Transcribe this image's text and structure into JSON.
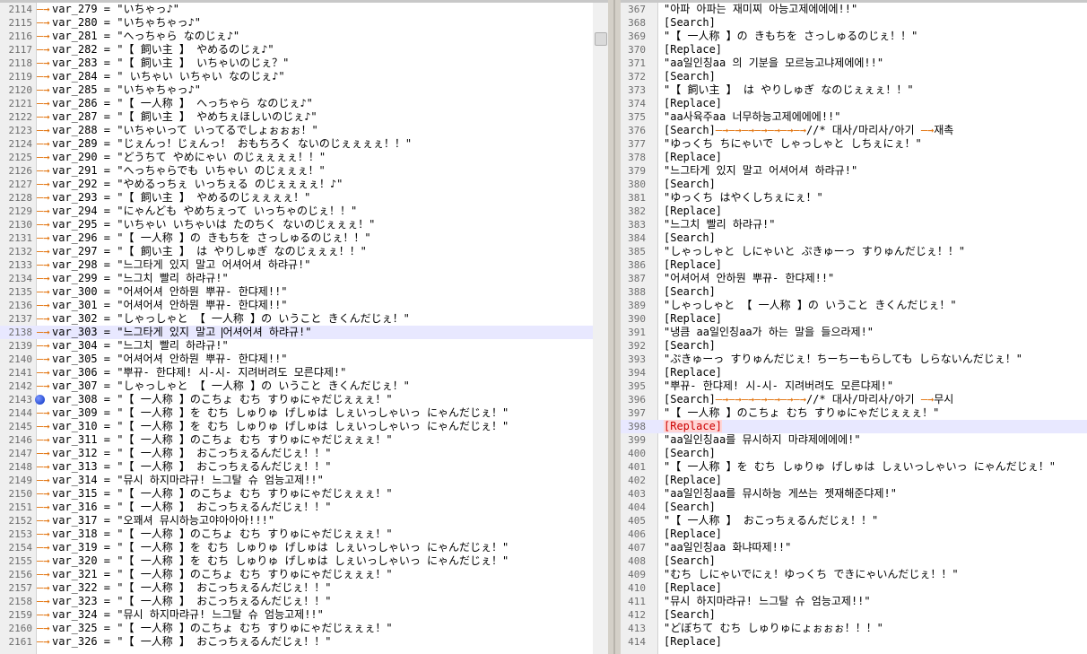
{
  "left_pane": {
    "current_line_index": 24,
    "bookmark_line_index": 29,
    "caret_after": "\"느그타게 있지 말고 ",
    "lines": [
      {
        "no": "2114",
        "text": "var_279 = \"いちゃっ♪\""
      },
      {
        "no": "2115",
        "text": "var_280 = \"いちゃちゃっ♪\""
      },
      {
        "no": "2116",
        "text": "var_281 = \"へっちゃら なのじぇ♪\""
      },
      {
        "no": "2117",
        "text": "var_282 = \"【 飼い主 】 やめるのじぇ♪\""
      },
      {
        "no": "2118",
        "text": "var_283 = \"【 飼い主 】 いちゃいのじぇ？\""
      },
      {
        "no": "2119",
        "text": "var_284 = \" いちゃい いちゃい なのじぇ♪\""
      },
      {
        "no": "2120",
        "text": "var_285 = \"いちゃちゃっ♪\""
      },
      {
        "no": "2121",
        "text": "var_286 = \"【 一人称 】 へっちゃら なのじぇ♪\""
      },
      {
        "no": "2122",
        "text": "var_287 = \"【 飼い主 】 やめちぇほしいのじぇ♪\""
      },
      {
        "no": "2123",
        "text": "var_288 = \"いちゃいって いってるでしょぉぉぉ！\""
      },
      {
        "no": "2124",
        "text": "var_289 = \"じぇんっ！じぇんっ！ おもちろく ないのじぇぇぇぇ！！\""
      },
      {
        "no": "2125",
        "text": "var_290 = \"どうちて やめにゃい のじぇぇぇぇ！！\""
      },
      {
        "no": "2126",
        "text": "var_291 = \"へっちゃらでも いちゃい のじぇぇぇ！\""
      },
      {
        "no": "2127",
        "text": "var_292 = \"やめるっちぇ いっちぇる のじぇぇぇぇ！♪\""
      },
      {
        "no": "2128",
        "text": "var_293 = \"【 飼い主 】 やめるのじぇぇぇぇ！\""
      },
      {
        "no": "2129",
        "text": "var_294 = \"にゃんども やめちぇって いっちゃのじぇ！！\""
      },
      {
        "no": "2130",
        "text": "var_295 = \"いちゃい いちゃいは たのちく ないのじぇぇぇ！\""
      },
      {
        "no": "2131",
        "text": "var_296 = \"【 一人称 】の きもちを さっしゅるのじぇ！！\""
      },
      {
        "no": "2132",
        "text": "var_297 = \"【 飼い主 】 は やりしゅぎ なのじぇぇぇ！！\""
      },
      {
        "no": "2133",
        "text": "var_298 = \"느그타게 있지 말고 어셔어셔 하랴규!\""
      },
      {
        "no": "2134",
        "text": "var_299 = \"느그치 빨리 하랴규!\""
      },
      {
        "no": "2135",
        "text": "var_300 = \"어셔어셔 안하뭔 뿌뀨- 한댜제!!\""
      },
      {
        "no": "2136",
        "text": "var_301 = \"어셔어셔 안하뭔 뿌뀨- 한댜제!!\""
      },
      {
        "no": "2137",
        "text": "var_302 = \"しゃっしゃと 【 一人称 】の いうこと きくんだじぇ！\""
      },
      {
        "no": "2138",
        "text": "var_303 = \"느그타게 있지 말고 어셔어셔 하랴규!\""
      },
      {
        "no": "2139",
        "text": "var_304 = \"느그치 빨리 하랴규!\""
      },
      {
        "no": "2140",
        "text": "var_305 = \"어셔어셔 안하뭔 뿌뀨- 한댜제!!\""
      },
      {
        "no": "2141",
        "text": "var_306 = \"뿌뀨- 한댜제! 시-시- 지려버려도 모른댜제!\""
      },
      {
        "no": "2142",
        "text": "var_307 = \"しゃっしゃと 【 一人称 】の いうこと きくんだじぇ！\""
      },
      {
        "no": "2143",
        "text": "var_308 = \"【 一人称 】のこちょ むち すりゅにゃだじぇぇぇ！\""
      },
      {
        "no": "2144",
        "text": "var_309 = \"【 一人称 】を むち しゅりゅ げしゅは しぇいっしゃいっ にゃんだじぇ！\""
      },
      {
        "no": "2145",
        "text": "var_310 = \"【 一人称 】を むち しゅりゅ げしゅは しぇいっしゃいっ にゃんだじぇ！\""
      },
      {
        "no": "2146",
        "text": "var_311 = \"【 一人称 】のこちょ むち すりゅにゃだじぇぇぇ！\""
      },
      {
        "no": "2147",
        "text": "var_312 = \"【 一人称 】 おこっちぇるんだじぇ！！\""
      },
      {
        "no": "2148",
        "text": "var_313 = \"【 一人称 】 おこっちぇるんだじぇ！！\""
      },
      {
        "no": "2149",
        "text": "var_314 = \"뮤시 하지마랴규! 느그탈 슈 엄능고제!!\""
      },
      {
        "no": "2150",
        "text": "var_315 = \"【 一人称 】のこちょ むち すりゅにゃだじぇぇぇ！\""
      },
      {
        "no": "2151",
        "text": "var_316 = \"【 一人称 】 おこっちぇるんだじぇ！！\""
      },
      {
        "no": "2152",
        "text": "var_317 = \"오꽤셔 뮤시하능고야아아아!!!\""
      },
      {
        "no": "2153",
        "text": "var_318 = \"【 一人称 】のこちょ むち すりゅにゃだじぇぇぇ！\""
      },
      {
        "no": "2154",
        "text": "var_319 = \"【 一人称 】を むち しゅりゅ げしゅは しぇいっしゃいっ にゃんだじぇ！\""
      },
      {
        "no": "2155",
        "text": "var_320 = \"【 一人称 】を むち しゅりゅ げしゅは しぇいっしゃいっ にゃんだじぇ！\""
      },
      {
        "no": "2156",
        "text": "var_321 = \"【 一人称 】のこちょ むち すりゅにゃだじぇぇぇ！\""
      },
      {
        "no": "2157",
        "text": "var_322 = \"【 一人称 】 おこっちぇるんだじぇ！！\""
      },
      {
        "no": "2158",
        "text": "var_323 = \"【 一人称 】 おこっちぇるんだじぇ！！\""
      },
      {
        "no": "2159",
        "text": "var_324 = \"뮤시 하지마랴규! 느그탈 슈 엄능고제!!\""
      },
      {
        "no": "2160",
        "text": "var_325 = \"【 一人称 】のこちょ むち すりゅにゃだじぇぇぇ！\""
      },
      {
        "no": "2161",
        "text": "var_326 = \"【 一人称 】 おこっちぇるんだじぇ！！\""
      }
    ]
  },
  "right_pane": {
    "current_line_index": 31,
    "lines": [
      {
        "no": "367",
        "text": "\"아파 아파는 재미찌 아능고제에에에!!\""
      },
      {
        "no": "368",
        "text": "[Search]"
      },
      {
        "no": "369",
        "text": "\"【 一人称 】の きもちを さっしゅるのじぇ！！\""
      },
      {
        "no": "370",
        "text": "[Replace]"
      },
      {
        "no": "371",
        "text": "\"aa일인칭aa 의 기분을 모르능고냐제에에!!\""
      },
      {
        "no": "372",
        "text": "[Search]"
      },
      {
        "no": "373",
        "text": "\"【 飼い主 】 は やりしゅぎ なのじぇぇぇ！！\""
      },
      {
        "no": "374",
        "text": "[Replace]"
      },
      {
        "no": "375",
        "text": "\"aa사육주aa 너무하능고제에에에!!\""
      },
      {
        "no": "376",
        "text": "[Search]",
        "tail": "//* 대사/마리사/아기 ",
        "tail2": "재촉"
      },
      {
        "no": "377",
        "text": "\"ゆっくち ちにゃいで しゃっしゃと しちぇにぇ！\""
      },
      {
        "no": "378",
        "text": "[Replace]"
      },
      {
        "no": "379",
        "text": "\"느그타게 있지 말고 어셔어셔 하랴규!\""
      },
      {
        "no": "380",
        "text": "[Search]"
      },
      {
        "no": "381",
        "text": "\"ゆっくち はやくしちぇにぇ！\""
      },
      {
        "no": "382",
        "text": "[Replace]"
      },
      {
        "no": "383",
        "text": "\"느그치 빨리 하랴규!\""
      },
      {
        "no": "384",
        "text": "[Search]"
      },
      {
        "no": "385",
        "text": "\"しゃっしゃと しにゃいと ぷきゅーっ すりゅんだじぇ！！\""
      },
      {
        "no": "386",
        "text": "[Replace]"
      },
      {
        "no": "387",
        "text": "\"어셔어셔 안하뭔 뿌뀨- 한댜제!!\""
      },
      {
        "no": "388",
        "text": "[Search]"
      },
      {
        "no": "389",
        "text": "\"しゃっしゃと 【 一人称 】の いうこと きくんだじぇ！\""
      },
      {
        "no": "390",
        "text": "[Replace]"
      },
      {
        "no": "391",
        "text": "\"냉큼 aa일인칭aa가 하는 말을 들으라제!\""
      },
      {
        "no": "392",
        "text": "[Search]"
      },
      {
        "no": "393",
        "text": "\"ぷきゅーっ すりゅんだじぇ！ちーちーもらしても しらないんだじぇ！\""
      },
      {
        "no": "394",
        "text": "[Replace]"
      },
      {
        "no": "395",
        "text": "\"뿌뀨- 한댜제! 시-시- 지려버려도 모른댜제!\""
      },
      {
        "no": "396",
        "text": "[Search]",
        "tail": "//* 대사/마리사/아기 ",
        "tail2": "무시"
      },
      {
        "no": "397",
        "text": "\"【 一人称 】のこちょ むち すりゅにゃだじぇぇぇ！\""
      },
      {
        "no": "398",
        "text": "[Replace]",
        "highlight": true
      },
      {
        "no": "399",
        "text": "\"aa일인칭aa를 뮤시하지 마랴제에에에!\""
      },
      {
        "no": "400",
        "text": "[Search]"
      },
      {
        "no": "401",
        "text": "\"【 一人称 】を むち しゅりゅ げしゅは しぇいっしゃいっ にゃんだじぇ！\""
      },
      {
        "no": "402",
        "text": "[Replace]"
      },
      {
        "no": "403",
        "text": "\"aa일인칭aa를 뮤시하능 게쓰는 젯재해준댜제!\""
      },
      {
        "no": "404",
        "text": "[Search]"
      },
      {
        "no": "405",
        "text": "\"【 一人称 】 おこっちぇるんだじぇ！！\""
      },
      {
        "no": "406",
        "text": "[Replace]"
      },
      {
        "no": "407",
        "text": "\"aa일인칭aa 화냐따제!!\""
      },
      {
        "no": "408",
        "text": "[Search]"
      },
      {
        "no": "409",
        "text": "\"むち しにゃいでにぇ！ゆっくち できにゃいんだじぇ！！\""
      },
      {
        "no": "410",
        "text": "[Replace]"
      },
      {
        "no": "411",
        "text": "\"뮤시 하지마랴규! 느그탈 슈 엄능고제!!\""
      },
      {
        "no": "412",
        "text": "[Search]"
      },
      {
        "no": "413",
        "text": "\"どぼちて むち しゅりゅにょぉぉぉ！！！\""
      },
      {
        "no": "414",
        "text": "[Replace]"
      }
    ]
  }
}
